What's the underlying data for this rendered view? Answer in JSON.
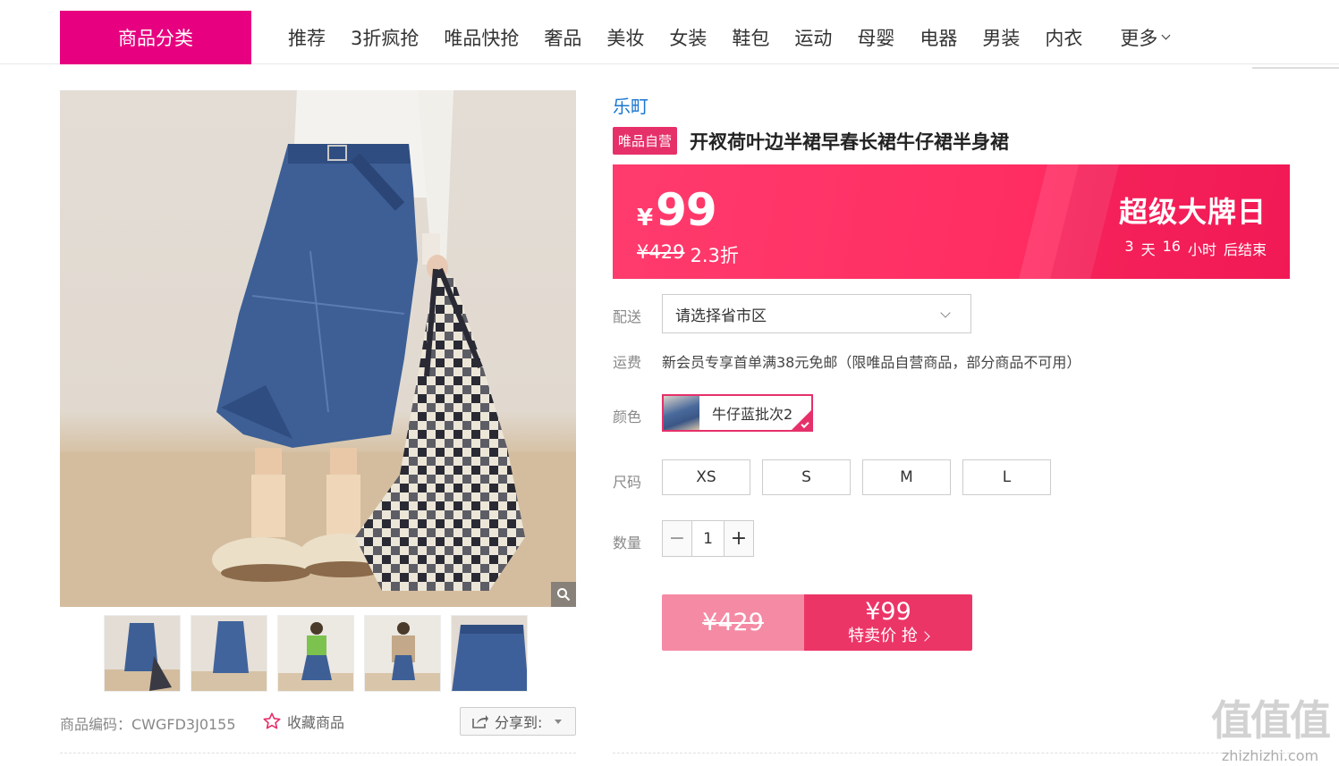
{
  "nav": {
    "category_button": "商品分类",
    "items": [
      "推荐",
      "3折疯抢",
      "唯品快抢",
      "奢品",
      "美妆",
      "女装",
      "鞋包",
      "运动",
      "母婴",
      "电器",
      "男装",
      "内衣"
    ],
    "more": "更多"
  },
  "gallery": {
    "zoom_icon": "magnifier-icon",
    "thumbnails": 5
  },
  "product": {
    "brand": "乐町",
    "self_operated_badge": "唯品自营",
    "title": "开衩荷叶边半裙早春长裙牛仔裙半身裙",
    "sku_label": "商品编码：CWGFD3J0155",
    "favorite_label": "收藏商品",
    "share_label": "分享到:"
  },
  "price": {
    "currency": "¥",
    "current": "99",
    "original": "¥429",
    "discount": "2.3折",
    "event_name": "超级大牌日",
    "countdown": [
      "3",
      "天",
      "16",
      "小时",
      "后结束"
    ]
  },
  "options": {
    "delivery_label": "配送",
    "region_placeholder": "请选择省市区",
    "shipping_label": "运费",
    "shipping_text": "新会员专享首单满38元免邮（限唯品自营商品，部分商品不可用）",
    "color_label": "颜色",
    "color_selected": "牛仔蓝批次2",
    "size_label": "尺码",
    "sizes": [
      "XS",
      "S",
      "M",
      "L"
    ],
    "quantity_label": "数量",
    "quantity": "1",
    "minus": "−",
    "plus": "+"
  },
  "buy": {
    "original": "¥429",
    "price": "¥99",
    "label": "特卖价 抢"
  },
  "watermark": {
    "big": "值值值",
    "small": "zhizhizhi.com"
  },
  "colors": {
    "brand_pink": "#e7007f",
    "banner_red": "#ff2d62",
    "link_blue": "#1976d2"
  }
}
